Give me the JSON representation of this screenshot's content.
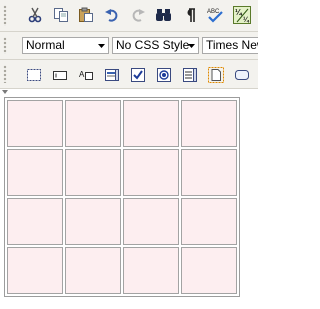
{
  "toolbar_top": {
    "buttons": [
      {
        "name": "cut",
        "icon": "cut-icon"
      },
      {
        "name": "copy",
        "icon": "copy-icon"
      },
      {
        "name": "paste",
        "icon": "paste-icon"
      },
      {
        "name": "undo",
        "icon": "undo-icon"
      },
      {
        "name": "redo",
        "icon": "redo-icon"
      },
      {
        "name": "find",
        "icon": "binoculars-icon"
      },
      {
        "name": "show-formatting",
        "icon": "pilcrow-icon"
      },
      {
        "name": "spellcheck",
        "icon": "spellcheck-icon"
      },
      {
        "name": "symbol",
        "icon": "symbol-icon"
      }
    ]
  },
  "format_bar": {
    "paragraph_style": "Normal",
    "css_style": "No CSS Style",
    "font_name": "Times New"
  },
  "form_toolbar": {
    "buttons": [
      {
        "name": "fieldset",
        "icon": "fieldset-icon"
      },
      {
        "name": "textbox",
        "icon": "textbox-icon"
      },
      {
        "name": "label",
        "icon": "label-icon"
      },
      {
        "name": "listbox",
        "icon": "listbox-icon"
      },
      {
        "name": "checkbox",
        "icon": "checkbox-icon"
      },
      {
        "name": "radio",
        "icon": "radio-icon"
      },
      {
        "name": "textarea",
        "icon": "textarea-icon"
      },
      {
        "name": "file-upload",
        "icon": "file-icon"
      },
      {
        "name": "button",
        "icon": "button-icon"
      }
    ]
  },
  "editor": {
    "table": {
      "rows": 4,
      "cols": 4,
      "cell_color": "#fdeef0"
    }
  }
}
